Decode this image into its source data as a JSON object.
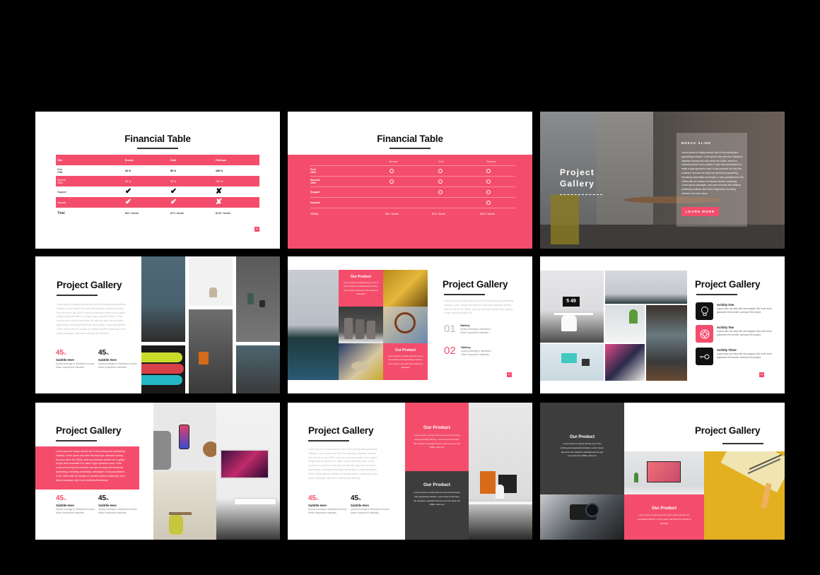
{
  "colors": {
    "accent": "#f44d6c",
    "dark": "#3d3d3d",
    "background": "#000000"
  },
  "slides": {
    "s1": {
      "title": "Financial Table",
      "header": [
        "Title",
        "Bronze",
        "Gold",
        "Platinum"
      ],
      "rows": [
        {
          "label": "First Offer",
          "values": [
            "20 %",
            "50 %",
            "100 %"
          ]
        },
        {
          "label": "Second Offer",
          "values": [
            "50 %",
            "20 %",
            "100 %"
          ]
        },
        {
          "label": "Support",
          "values": [
            "check",
            "check",
            "cross"
          ]
        },
        {
          "label": "Deposit",
          "values": [
            "check",
            "check",
            "cross"
          ]
        }
      ],
      "total": {
        "label": "Total",
        "values": [
          "$50 / Month",
          "$75 / Month",
          "$100 / Month"
        ]
      },
      "page": "15"
    },
    "s2": {
      "title": "Financial Table",
      "header": [
        "",
        "Bronze",
        "Gold",
        "Platinum"
      ],
      "rows": [
        {
          "label": "First Offer",
          "values": [
            true,
            true,
            true
          ]
        },
        {
          "label": "Second Offer",
          "values": [
            true,
            true,
            true
          ]
        },
        {
          "label": "Support",
          "values": [
            false,
            true,
            true
          ]
        },
        {
          "label": "Deposit",
          "values": [
            false,
            false,
            true
          ]
        }
      ],
      "total": {
        "label": "TOTAL",
        "values": [
          "$50 / Month",
          "$75 / Month",
          "$100 / Month"
        ]
      }
    },
    "s3": {
      "title_line1": "Project",
      "title_line2": "Gallery",
      "kicker": "BREAK SLIDE",
      "body": "Lorem Ipsum is simply dummy text of the printing and typesetting industry. Lorem Ipsum has been the industry's standard dummy text ever since the 1500s, when an unknown printer took a galley of type and scrambled it to make a type specimen book. It has survived not only five centuries, but also the leap into electronic typesetting, remaining essentially unchanged. It was popularised in the 1960s with the release of Letraset sheets containing Lorem Ipsum passages, and more recently with desktop publishing software like Aldus PageMaker including versions of Lorem Ipsum.",
      "button": "LEARN MORE"
    },
    "s4": {
      "title": "Project Gallery",
      "body": "Lorem Ipsum is simply dummy text of the printing and typesetting industry. Lorem Ipsum has been the industry's standard dummy text ever since the 1500s, when an unknown printer took a galley of type and scrambled it to make a type specimen book. It has survived not only five centuries, but also the leap into electronic typesetting, remaining essentially unchanged. It was popularised in the 1960s with the release of Letraset sheets containing Lorem Ipsum passages, and more recently with desktop.",
      "stats": [
        {
          "value": "45",
          "unit": "%",
          "subtitle": "Subtitle Here",
          "desc": "Quickly leverage to distributed sources rather empowered materials."
        },
        {
          "value": "45",
          "unit": "%",
          "subtitle": "Subtitle Here",
          "desc": "Quickly leverage to distributed sources rather empowered materials."
        }
      ]
    },
    "s5": {
      "title": "Project Gallery",
      "body": "Lorem Ipsum is simply dummy text of the printing and typesetting industry. Lorem Ipsum has been the industry's standard dummy text ever since the 1500s, when an unknown printer took a galley of type and scrambled it to.",
      "product1": {
        "title": "Our Product",
        "body": "Lorem Ipsum is simply dummy text of the printing and typesetting industry. Lorem Ipsum has been the industry's standard"
      },
      "product2": {
        "title": "Our Product",
        "body": "Lorem Ipsum is simply dummy text of the printing and typesetting industry. Lorem Ipsum has been the industry's standard"
      },
      "items": [
        {
          "num": "01",
          "title": "Gallery",
          "desc": "Quickly leverage to distributed rather empowered materials."
        },
        {
          "num": "02",
          "title": "Gallery",
          "desc": "Quickly leverage to distributed rather empowered materials."
        }
      ],
      "page": "11"
    },
    "s6": {
      "title": "Project Gallery",
      "clock": "5 49",
      "activities": [
        {
          "icon": "lightbulb-icon",
          "title": "Activity One",
          "desc": "A good plan can help with risk analysis. But it will never guarantee the smooth running of the project."
        },
        {
          "icon": "lifebuoy-icon",
          "title": "Activity Two",
          "desc": "A good plan can help with risk analysis. But it will never guarantee the smooth running of the project."
        },
        {
          "icon": "key-icon",
          "title": "Activity Three",
          "desc": "A good plan can help with risk analysis. But it will never guarantee the smooth running of the project."
        }
      ],
      "page": "18"
    },
    "s7": {
      "title": "Project Gallery",
      "body": "Lorem Ipsum is simply dummy text of the printing and typesetting industry. Lorem Ipsum has been the industry's standard dummy text ever since the 1500s, when an unknown printer took a galley of type and scrambled it to make a type specimen book. It has survived not only five centuries, but also the leap into electronic typesetting, remaining essentially unchanged. It was popularised in the 1960s with the release of Letraset sheets containing Lorem Ipsum passages, and more recently with desktop.",
      "stats": [
        {
          "value": "45",
          "unit": "%",
          "subtitle": "Subtitle Here",
          "desc": "Quickly leverage to distributed sources rather empowered materials."
        },
        {
          "value": "45",
          "unit": "%",
          "subtitle": "Subtitle Here",
          "desc": "Quickly leverage to distributed sources rather empowered materials."
        }
      ]
    },
    "s8": {
      "title": "Project Gallery",
      "body": "Lorem Ipsum is simply dummy text of the printing and typesetting industry. Lorem Ipsum has been the industry's standard dummy text ever since the 1500s, when an unknown printer took a galley of type and scrambled it to make a type specimen book. It has survived not only five centuries, but also the leap into electronic typesetting, remaining essentially unchanged. It was popularised in the 1960s with the release of Letraset sheets containing Lorem Ipsum passages, and more recently with desktop.",
      "stats": [
        {
          "value": "45",
          "unit": "%",
          "subtitle": "Subtitle Here",
          "desc": "Quickly leverage to distributed sources rather empowered materials."
        },
        {
          "value": "45",
          "unit": "%",
          "subtitle": "Subtitle Here",
          "desc": "Quickly leverage to distributed sources rather empowered materials."
        }
      ],
      "product1": {
        "title": "Our Product",
        "body": "Lorem Ipsum is simply dummy text of the printing and typesetting industry. Lorem Ipsum has been the industry's standard dummy text ever since the 1500s, when an"
      },
      "product2": {
        "title": "Our Product",
        "body": "Lorem Ipsum is simply dummy text of the printing and typesetting industry. Lorem Ipsum has been the industry's standard dummy text ever since the 1500s, when an"
      }
    },
    "s9": {
      "title": "Project Gallery",
      "product1": {
        "title": "Our Product",
        "body": "Lorem Ipsum is simply dummy text of the printing and typesetting industry. Lorem Ipsum has been the industry's standard dummy text ever since the 1500s, when an"
      },
      "product2": {
        "title": "Our Product",
        "body": "Lorem Ipsum is simply dummy text of the printing and typesetting industry. Lorem Ipsum has been the industry's standard"
      }
    }
  }
}
